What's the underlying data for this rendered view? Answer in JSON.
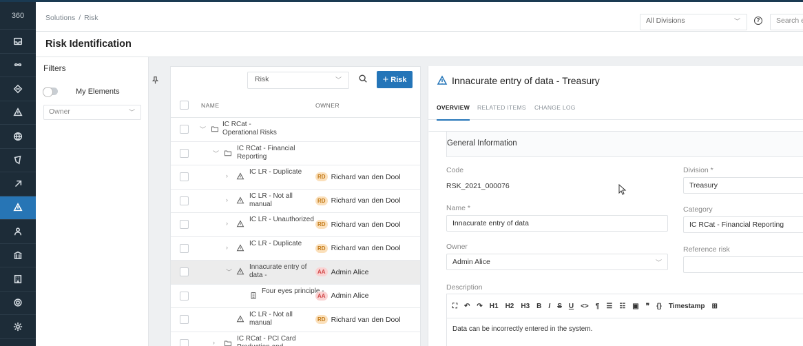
{
  "nav": {
    "logo": "360",
    "items": [
      {
        "icon": "inbox-icon",
        "active": false
      },
      {
        "icon": "infinity-icon",
        "active": false
      },
      {
        "icon": "process-icon",
        "active": false
      },
      {
        "icon": "warning-icon",
        "active": false
      },
      {
        "icon": "globe-icon",
        "active": false
      },
      {
        "icon": "shield-icon",
        "active": false
      },
      {
        "icon": "link-icon",
        "active": false
      },
      {
        "icon": "risk-icon",
        "active": true
      },
      {
        "icon": "users-icon",
        "active": false
      },
      {
        "icon": "bank-icon",
        "active": false
      },
      {
        "icon": "building-icon",
        "active": false
      },
      {
        "icon": "settings-icon",
        "active": false
      },
      {
        "icon": "gear-icon",
        "active": false
      }
    ]
  },
  "header": {
    "breadcrumb_1": "Solutions",
    "breadcrumb_sep": "/",
    "breadcrumb_2": "Risk",
    "division_select": "All Divisions",
    "search_placeholder": "Search e"
  },
  "page": {
    "title": "Risk Identification"
  },
  "filters": {
    "title": "Filters",
    "my_elements_label": "My Elements",
    "owner_placeholder": "Owner"
  },
  "list": {
    "type_select": "Risk",
    "add_button": "Risk",
    "col_name": "NAME",
    "col_owner": "OWNER",
    "rows": [
      {
        "name": "IC RCat - Operational Risks",
        "owner": "",
        "initials": ""
      },
      {
        "name": "IC RCat - Financial Reporting",
        "owner": "",
        "initials": ""
      },
      {
        "name": "IC LR - Duplicate",
        "owner": "Richard van den Dool",
        "initials": "RD"
      },
      {
        "name": "IC LR - Not all manual",
        "owner": "Richard van den Dool",
        "initials": "RD"
      },
      {
        "name": "IC LR - Unauthorized",
        "owner": "Richard van den Dool",
        "initials": "RD"
      },
      {
        "name": "IC LR - Duplicate",
        "owner": "Richard van den Dool",
        "initials": "RD"
      },
      {
        "name": "Innacurate entry of data -",
        "owner": "Admin Alice",
        "initials": "AA"
      },
      {
        "name": "Four eyes principle -",
        "owner": "Admin Alice",
        "initials": "AA"
      },
      {
        "name": "IC LR - Not all manual",
        "owner": "Richard van den Dool",
        "initials": "RD"
      },
      {
        "name": "IC RCat - PCI Card Production and",
        "owner": "",
        "initials": ""
      }
    ]
  },
  "detail": {
    "title": "Innacurate entry of data - Treasury",
    "tabs": [
      "OVERVIEW",
      "RELATED ITEMS",
      "CHANGE LOG"
    ],
    "section_title": "General Information",
    "code_label": "Code",
    "code_value": "RSK_2021_000076",
    "division_label": "Division *",
    "division_value": "Treasury",
    "name_label": "Name *",
    "name_value": "Innacurate entry of data",
    "category_label": "Category",
    "category_value": "IC RCat - Financial Reporting",
    "owner_label": "Owner",
    "owner_value": "Admin Alice",
    "reference_label": "Reference risk",
    "reference_value": "",
    "description_label": "Description",
    "toolbar": [
      "⛶",
      "↶",
      "↷",
      "H1",
      "H2",
      "H3",
      "B",
      "I",
      "S",
      "U",
      "<>",
      "¶",
      "☰",
      "☷",
      "▣",
      "❞",
      "{}",
      "Timestamp",
      "⊞"
    ],
    "description_text": "Data can be incorrectly entered in the system."
  }
}
